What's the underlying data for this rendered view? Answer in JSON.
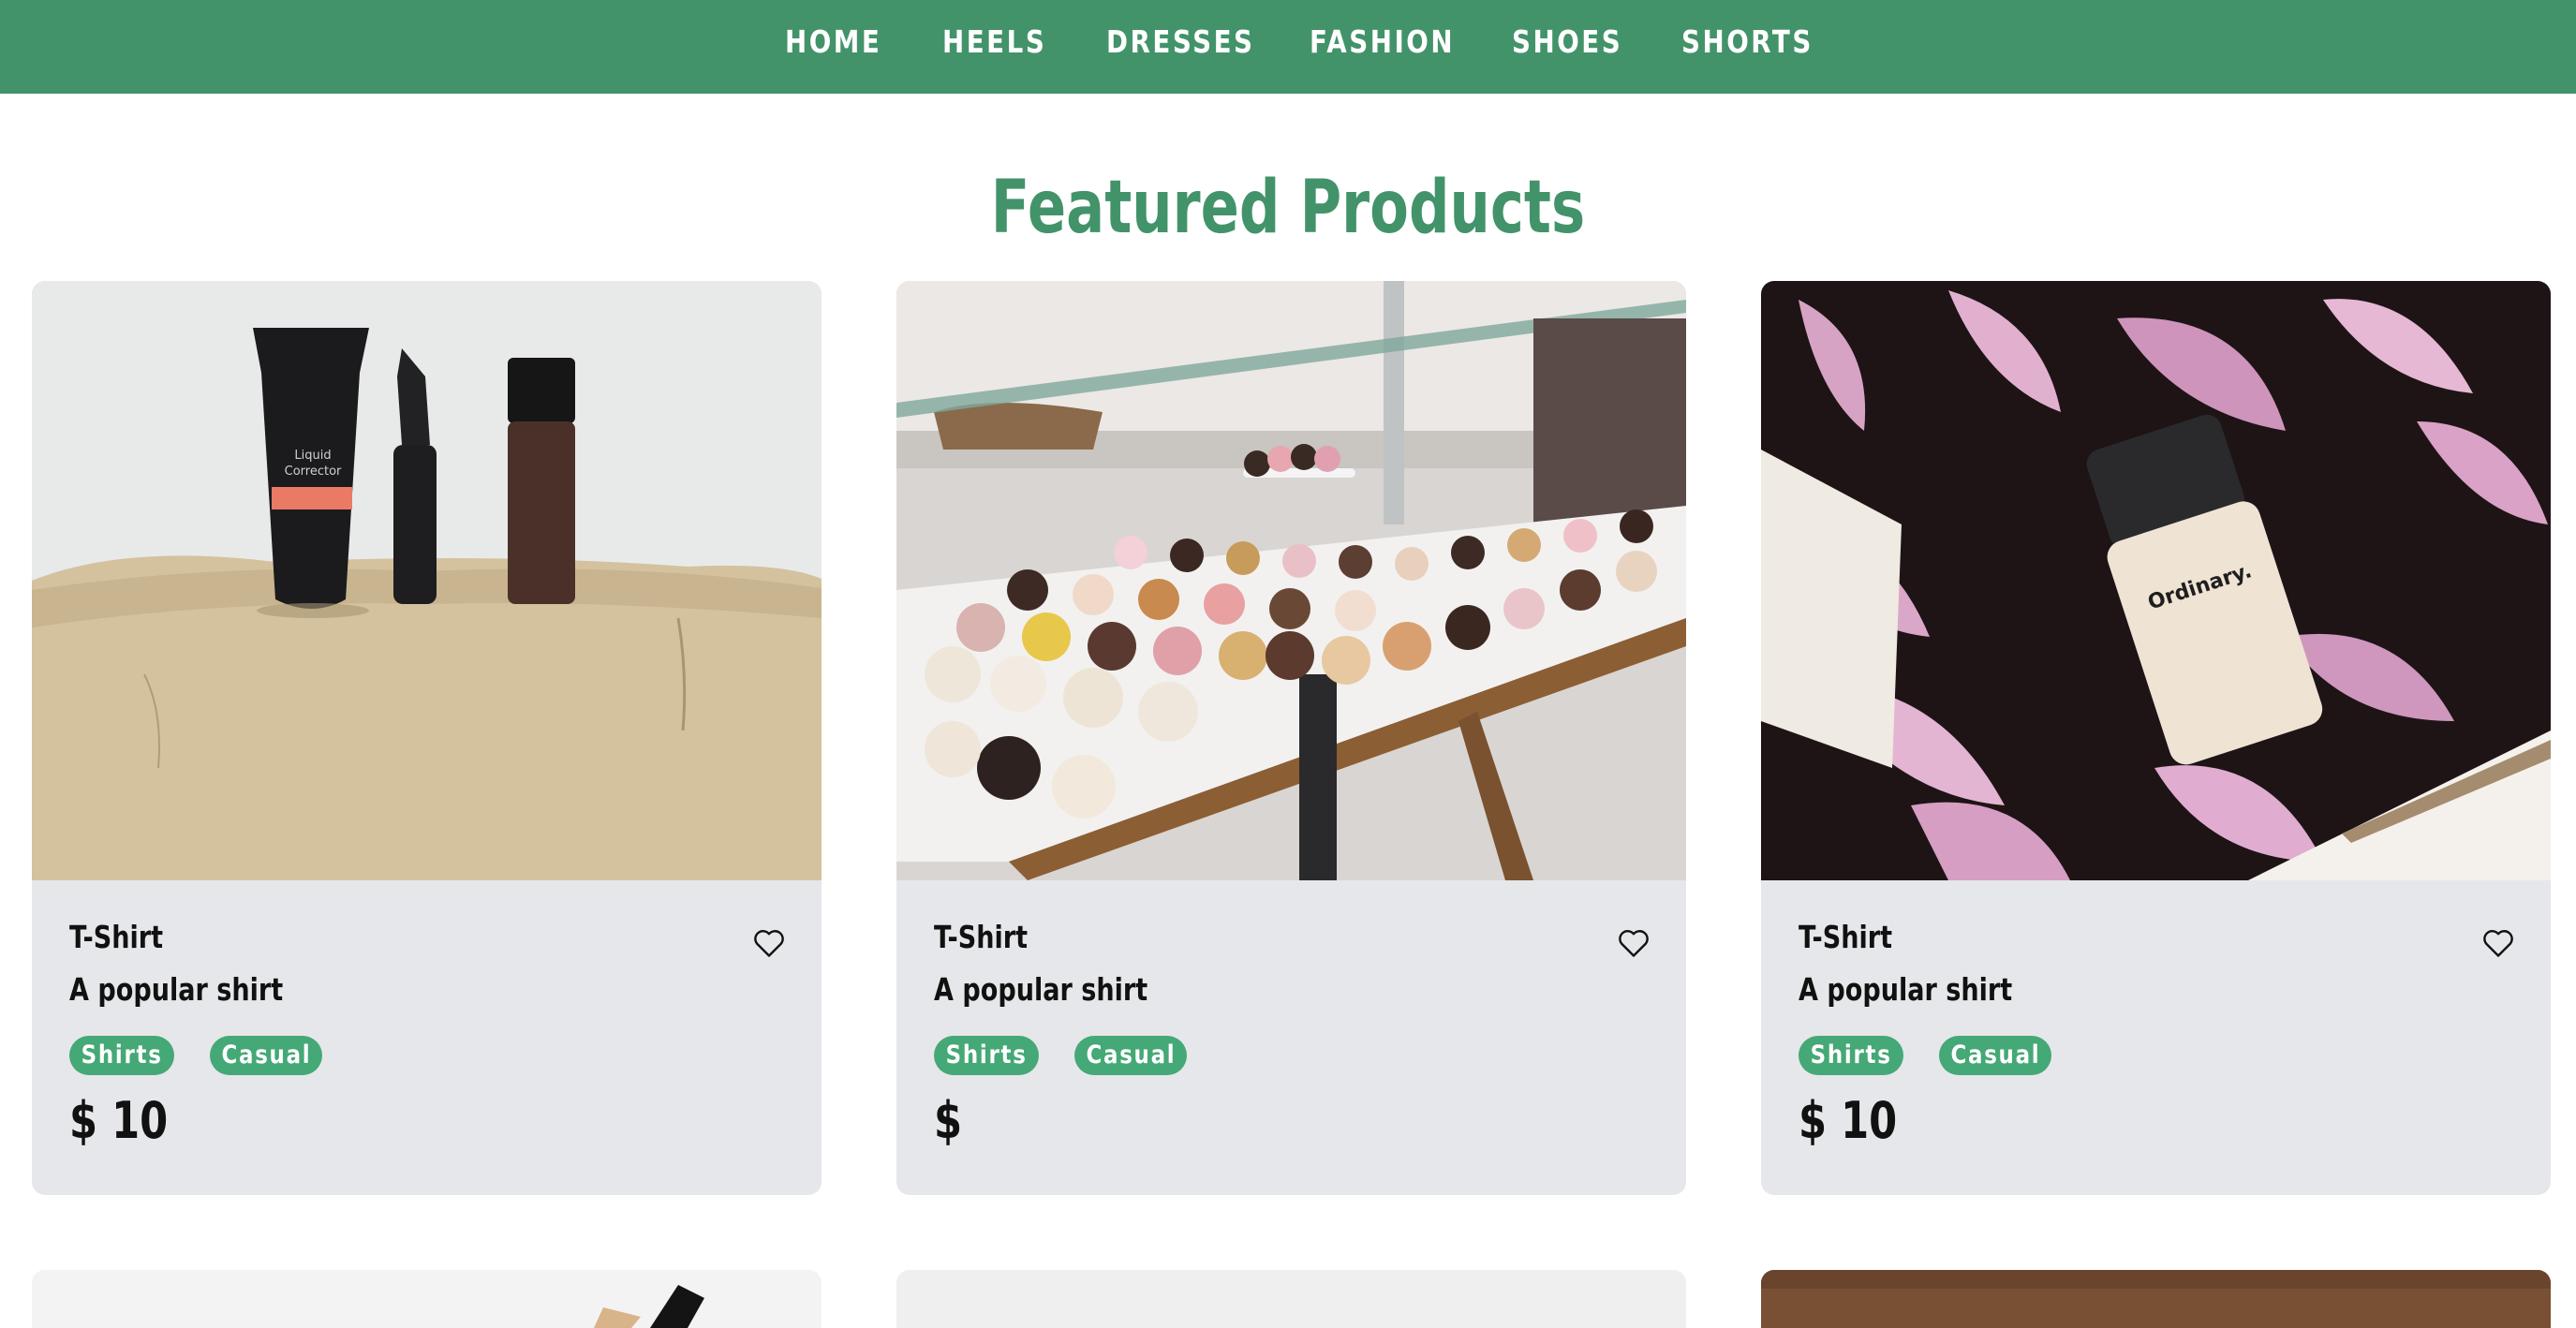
{
  "nav": {
    "items": [
      "HOME",
      "HEELS",
      "DRESSES",
      "FASHION",
      "SHOES",
      "SHORTS"
    ]
  },
  "section": {
    "title": "Featured Products"
  },
  "products": [
    {
      "name": "T-Shirt",
      "description": "A popular shirt",
      "tags": [
        "Shirts",
        "Casual"
      ],
      "price": "$ 10",
      "image": "cosmetics-on-beige-table"
    },
    {
      "name": "T-Shirt",
      "description": "A popular shirt",
      "tags": [
        "Shirts",
        "Casual"
      ],
      "price": "$",
      "image": "pastry-display-case"
    },
    {
      "name": "T-Shirt",
      "description": "A popular shirt",
      "tags": [
        "Shirts",
        "Casual"
      ],
      "price": "$ 10",
      "image": "foundation-bottle-on-petals"
    }
  ],
  "colors": {
    "navbar": "#43936a",
    "title": "#43936a",
    "tag": "#45a877",
    "card": "#e6e7ea"
  }
}
